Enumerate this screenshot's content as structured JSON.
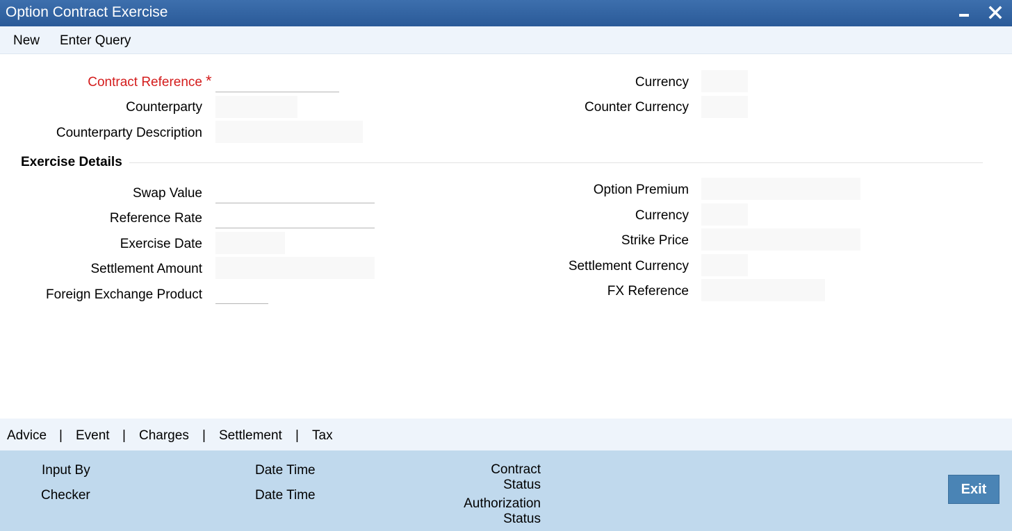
{
  "window": {
    "title": "Option Contract Exercise"
  },
  "toolbar": {
    "new_label": "New",
    "enter_query_label": "Enter Query"
  },
  "header_fields": {
    "contract_reference": {
      "label": "Contract Reference",
      "required_mark": "*",
      "value": ""
    },
    "counterparty": {
      "label": "Counterparty",
      "value": ""
    },
    "counterparty_description": {
      "label": "Counterparty Description",
      "value": ""
    },
    "currency": {
      "label": "Currency",
      "value": ""
    },
    "counter_currency": {
      "label": "Counter Currency",
      "value": ""
    }
  },
  "exercise_details": {
    "section_title": "Exercise Details",
    "swap_value": {
      "label": "Swap Value",
      "value": ""
    },
    "reference_rate": {
      "label": "Reference Rate",
      "value": ""
    },
    "exercise_date": {
      "label": "Exercise Date",
      "value": ""
    },
    "settlement_amount": {
      "label": "Settlement Amount",
      "value": ""
    },
    "foreign_exchange_product": {
      "label": "Foreign Exchange Product",
      "value": ""
    },
    "option_premium": {
      "label": "Option Premium",
      "value": ""
    },
    "premium_currency": {
      "label": "Currency",
      "value": ""
    },
    "strike_price": {
      "label": "Strike Price",
      "value": ""
    },
    "settlement_currency": {
      "label": "Settlement Currency",
      "value": ""
    },
    "fx_reference": {
      "label": "FX Reference",
      "value": ""
    }
  },
  "subtabs": {
    "advice": "Advice",
    "event": "Event",
    "charges": "Charges",
    "settlement": "Settlement",
    "tax": "Tax",
    "separator": "|"
  },
  "footer": {
    "input_by": "Input By",
    "checker": "Checker",
    "date_time_1": "Date Time",
    "date_time_2": "Date Time",
    "contract_status_line1": "Contract",
    "contract_status_line2": "Status",
    "authorization_status_line1": "Authorization",
    "authorization_status_line2": "Status",
    "exit_label": "Exit"
  },
  "colors": {
    "title_bar": "#2f62a3",
    "required_label": "#d41c1c",
    "footer_bg": "#c0d9ed",
    "exit_button": "#4a84b5"
  }
}
